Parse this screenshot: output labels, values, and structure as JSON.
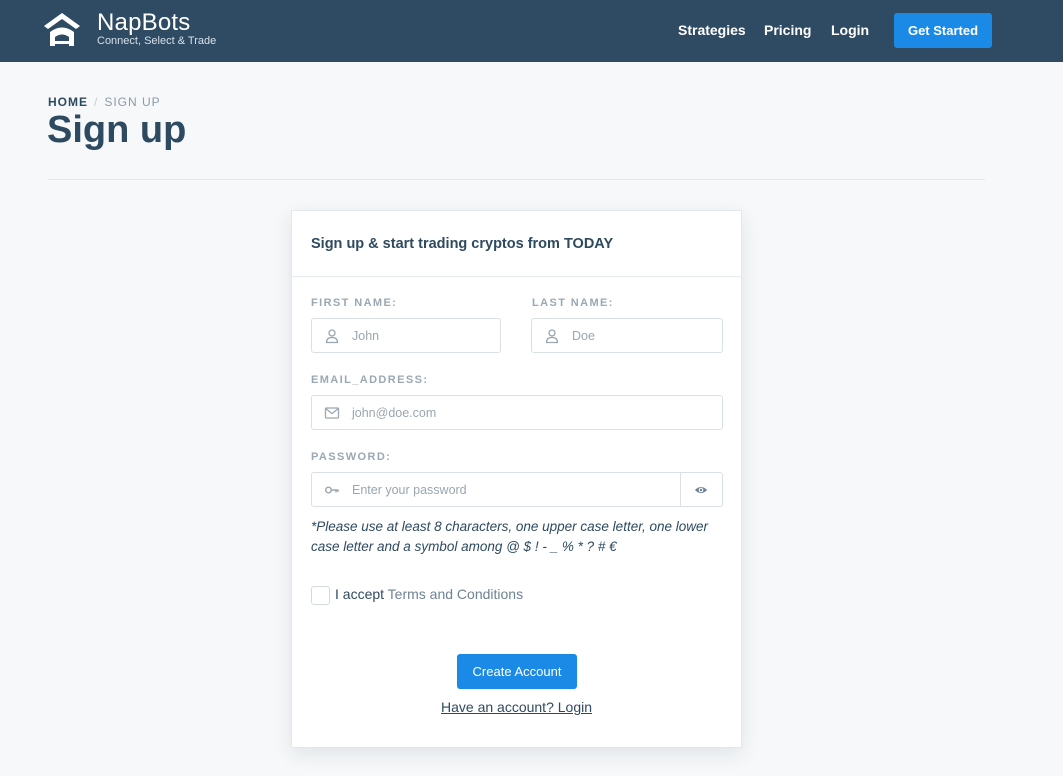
{
  "header": {
    "brand_name": "NapBots",
    "brand_tagline": "Connect, Select & Trade",
    "nav": {
      "strategies": "Strategies",
      "pricing": "Pricing",
      "login": "Login"
    },
    "cta_label": "Get Started"
  },
  "breadcrumb": {
    "home": "HOME",
    "separator": "/",
    "current": "SIGN UP"
  },
  "page_title": "Sign up",
  "form": {
    "title": "Sign up & start trading cryptos from TODAY",
    "first_name": {
      "label": "FIRST NAME:",
      "placeholder": "John",
      "icon": "user-icon"
    },
    "last_name": {
      "label": "LAST NAME:",
      "placeholder": "Doe",
      "icon": "user-icon"
    },
    "email": {
      "label": "EMAIL_ADDRESS:",
      "placeholder": "john@doe.com",
      "icon": "envelope-icon"
    },
    "password": {
      "label": "PASSWORD:",
      "placeholder": "Enter your password",
      "icon": "key-icon",
      "toggle_icon": "eye-icon"
    },
    "password_hint": "*Please use at least 8 characters, one upper case letter, one lower case letter and a symbol among @ $ ! - _ % * ? # €",
    "accept_prefix": "I accept",
    "accept_terms_link": "Terms and Conditions",
    "submit_label": "Create Account",
    "login_link": "Have an account? Login"
  },
  "colors": {
    "header_bg": "#2f4b63",
    "accent": "#1a8ae6",
    "text": "#2e4a60",
    "label": "#9aa8b4",
    "page_bg": "#f6f8f9"
  }
}
